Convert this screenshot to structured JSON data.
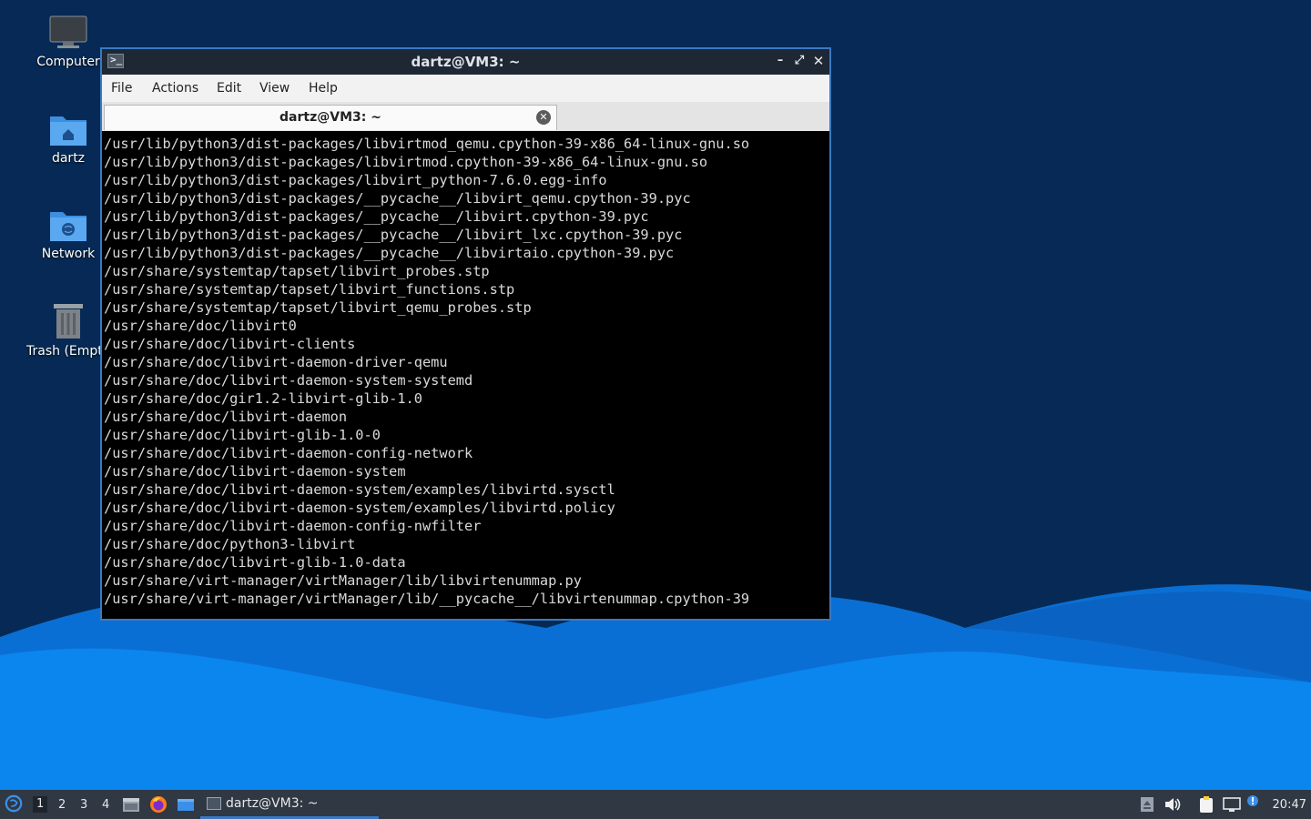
{
  "desktop": {
    "icons": [
      {
        "label": "Computer",
        "icon": "computer-icon"
      },
      {
        "label": "dartz",
        "icon": "home-folder-icon"
      },
      {
        "label": "Network",
        "icon": "network-folder-icon"
      },
      {
        "label": "Trash (Empt",
        "icon": "trash-icon"
      }
    ]
  },
  "window": {
    "title": "dartz@VM3: ~",
    "menu": [
      "File",
      "Actions",
      "Edit",
      "View",
      "Help"
    ],
    "tab_label": "dartz@VM3: ~",
    "output": [
      "/usr/lib/python3/dist-packages/libvirtmod_qemu.cpython-39-x86_64-linux-gnu.so",
      "/usr/lib/python3/dist-packages/libvirtmod.cpython-39-x86_64-linux-gnu.so",
      "/usr/lib/python3/dist-packages/libvirt_python-7.6.0.egg-info",
      "/usr/lib/python3/dist-packages/__pycache__/libvirt_qemu.cpython-39.pyc",
      "/usr/lib/python3/dist-packages/__pycache__/libvirt.cpython-39.pyc",
      "/usr/lib/python3/dist-packages/__pycache__/libvirt_lxc.cpython-39.pyc",
      "/usr/lib/python3/dist-packages/__pycache__/libvirtaio.cpython-39.pyc",
      "/usr/share/systemtap/tapset/libvirt_probes.stp",
      "/usr/share/systemtap/tapset/libvirt_functions.stp",
      "/usr/share/systemtap/tapset/libvirt_qemu_probes.stp",
      "/usr/share/doc/libvirt0",
      "/usr/share/doc/libvirt-clients",
      "/usr/share/doc/libvirt-daemon-driver-qemu",
      "/usr/share/doc/libvirt-daemon-system-systemd",
      "/usr/share/doc/gir1.2-libvirt-glib-1.0",
      "/usr/share/doc/libvirt-daemon",
      "/usr/share/doc/libvirt-glib-1.0-0",
      "/usr/share/doc/libvirt-daemon-config-network",
      "/usr/share/doc/libvirt-daemon-system",
      "/usr/share/doc/libvirt-daemon-system/examples/libvirtd.sysctl",
      "/usr/share/doc/libvirt-daemon-system/examples/libvirtd.policy",
      "/usr/share/doc/libvirt-daemon-config-nwfilter",
      "/usr/share/doc/python3-libvirt",
      "/usr/share/doc/libvirt-glib-1.0-data",
      "/usr/share/virt-manager/virtManager/lib/libvirtenummap.py",
      "/usr/share/virt-manager/virtManager/lib/__pycache__/libvirtenummap.cpython-39"
    ]
  },
  "taskbar": {
    "workspaces": [
      "1",
      "2",
      "3",
      "4"
    ],
    "active_workspace": "1",
    "task_label": "dartz@VM3: ~",
    "clock": "20:47"
  },
  "colors": {
    "accent": "#3b78c4",
    "taskbar_bg": "#2f3843",
    "terminal_bg": "#000000"
  }
}
